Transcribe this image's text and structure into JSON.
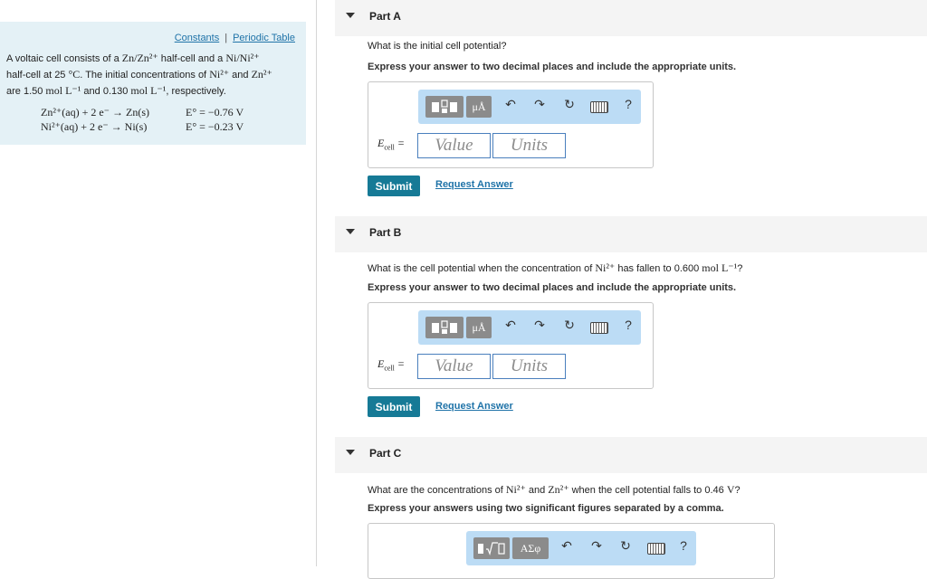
{
  "left": {
    "constants_link": "Constants",
    "separator": "|",
    "periodic_link": "Periodic Table",
    "problem": {
      "t1": "A voltaic cell consists of a ",
      "m1": "Zn/Zn²⁺",
      "t2": " half-cell and a ",
      "m2": "Ni/Ni²⁺",
      "t3": "half-cell at 25 ",
      "m3": "°C",
      "t4": ". The initial concentrations of ",
      "m4": "Ni²⁺",
      "t5": " and ",
      "m5": "Zn²⁺",
      "t6": "are 1.50 ",
      "m6": "mol L⁻¹",
      "t7": " and 0.130 ",
      "m7": "mol L⁻¹",
      "t8": ", respectively."
    },
    "equations": [
      {
        "reaction": "Zn²⁺(aq) + 2 e⁻ → Zn(s)",
        "potential": "E° = −0.76 V"
      },
      {
        "reaction": "Ni²⁺(aq) + 2 e⁻ → Ni(s)",
        "potential": "E° = −0.23 V"
      }
    ]
  },
  "parts": [
    {
      "title": "Part A",
      "question": "What is the initial cell potential?",
      "instruction": "Express your answer to two decimal places and include the appropriate units.",
      "label": "E",
      "label_sub": "cell",
      "label_eq": " =",
      "value_placeholder": "Value",
      "units_placeholder": "Units",
      "submit": "Submit",
      "request": "Request Answer"
    },
    {
      "title": "Part B",
      "question_pre": "What is the cell potential when the concentration of ",
      "question_m1": "Ni²⁺",
      "question_mid": " has fallen to 0.600 ",
      "question_m2": "mol L⁻¹",
      "question_post": "?",
      "instruction": "Express your answer to two decimal places and include the appropriate units.",
      "label": "E",
      "label_sub": "cell",
      "label_eq": " =",
      "value_placeholder": "Value",
      "units_placeholder": "Units",
      "submit": "Submit",
      "request": "Request Answer"
    },
    {
      "title": "Part C",
      "question_pre": "What are the concentrations of ",
      "question_m1": "Ni²⁺",
      "question_mid": " and ",
      "question_m2": "Zn²⁺",
      "question_post": " when the cell potential falls to 0.46 ",
      "question_m3": "V",
      "question_end": "?",
      "instruction": "Express your answers using two significant figures separated by a comma."
    }
  ],
  "toolbar": {
    "units_button": "μÅ",
    "greek_button": "ΑΣφ",
    "help": "?"
  }
}
